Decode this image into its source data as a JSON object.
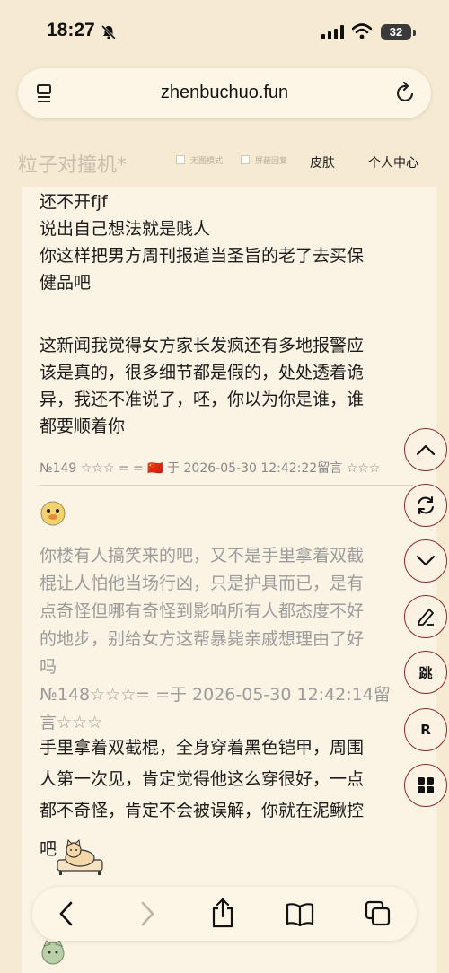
{
  "status_bar": {
    "time": "18:27",
    "battery": "32"
  },
  "browser": {
    "url": "zhenbuchuo.fun"
  },
  "site": {
    "title": "粒子对撞机*",
    "options": [
      {
        "label": "无图模式"
      },
      {
        "label": "屏蔽回复"
      }
    ],
    "links": {
      "skin": "皮肤",
      "profile": "个人中心"
    }
  },
  "posts": {
    "first": {
      "lines": [
        "还不开fjf",
        "说出自己想法就是贱人",
        "你这样把男方周刊报道当圣旨的老了去买保",
        "健品吧"
      ],
      "lines2": [
        "这新闻我觉得女方家长发疯还有多地报警应",
        "该是真的，很多细节都是假的，处处透着诡",
        "异，我还不准说了，呸，你以为你是谁，谁",
        "都要顺着你"
      ],
      "meta": "№149 ☆☆☆ = = 🇨🇳 于 2026-05-30 12:42:22留言 ☆☆☆"
    },
    "second": {
      "quote_lines": [
        "你楼有人搞笑来的吧，又不是手里拿着双截",
        "棍让人怕他当场行凶，只是护具而已，是有",
        "点奇怪但哪有奇怪到影响所有人都态度不好",
        "的地步，别给女方这帮暴毙亲戚想理由了好",
        "吗",
        "№148☆☆☆= =于 2026-05-30 12:42:14留",
        "言☆☆☆"
      ],
      "reply_lines": [
        "手里拿着双截棍，全身穿着黑色铠甲，周围",
        "人第一次见，肯定觉得他这么穿很好，一点",
        "都不奇怪，肯定不会被误解，你就在泥鳅控",
        "吧"
      ]
    }
  },
  "side_buttons": {
    "jump": "跳",
    "refresh_r": "R"
  },
  "colors": {
    "background": "#f6ead2",
    "card": "#fbf3e4",
    "fab_border": "#8a2a2a"
  }
}
